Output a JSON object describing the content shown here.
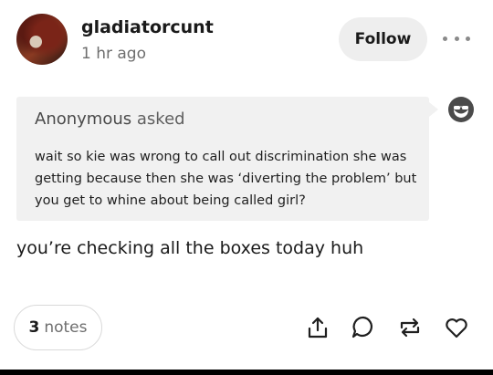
{
  "post": {
    "username": "gladiatorcunt",
    "timestamp": "1 hr ago",
    "follow_label": "Follow",
    "more_icon": "more-horizontal-icon"
  },
  "ask": {
    "asker": "Anonymous",
    "asked_word": "asked",
    "question": "wait so kie was wrong to call out discrimination she was getting because then she was ‘diverting the problem’ but you get to whine about being called girl?",
    "asker_icon": "anonymous-sunglasses-icon"
  },
  "answer": {
    "text": "you’re checking all the boxes today huh"
  },
  "footer": {
    "notes_count": "3",
    "notes_word": "notes",
    "actions": [
      "share-icon",
      "reply-icon",
      "reblog-icon",
      "like-icon"
    ]
  },
  "colors": {
    "background": "#ffffff",
    "ask_background": "#f1f1f1",
    "button_background": "#eeeeee",
    "muted_text": "#6e6e6e"
  }
}
